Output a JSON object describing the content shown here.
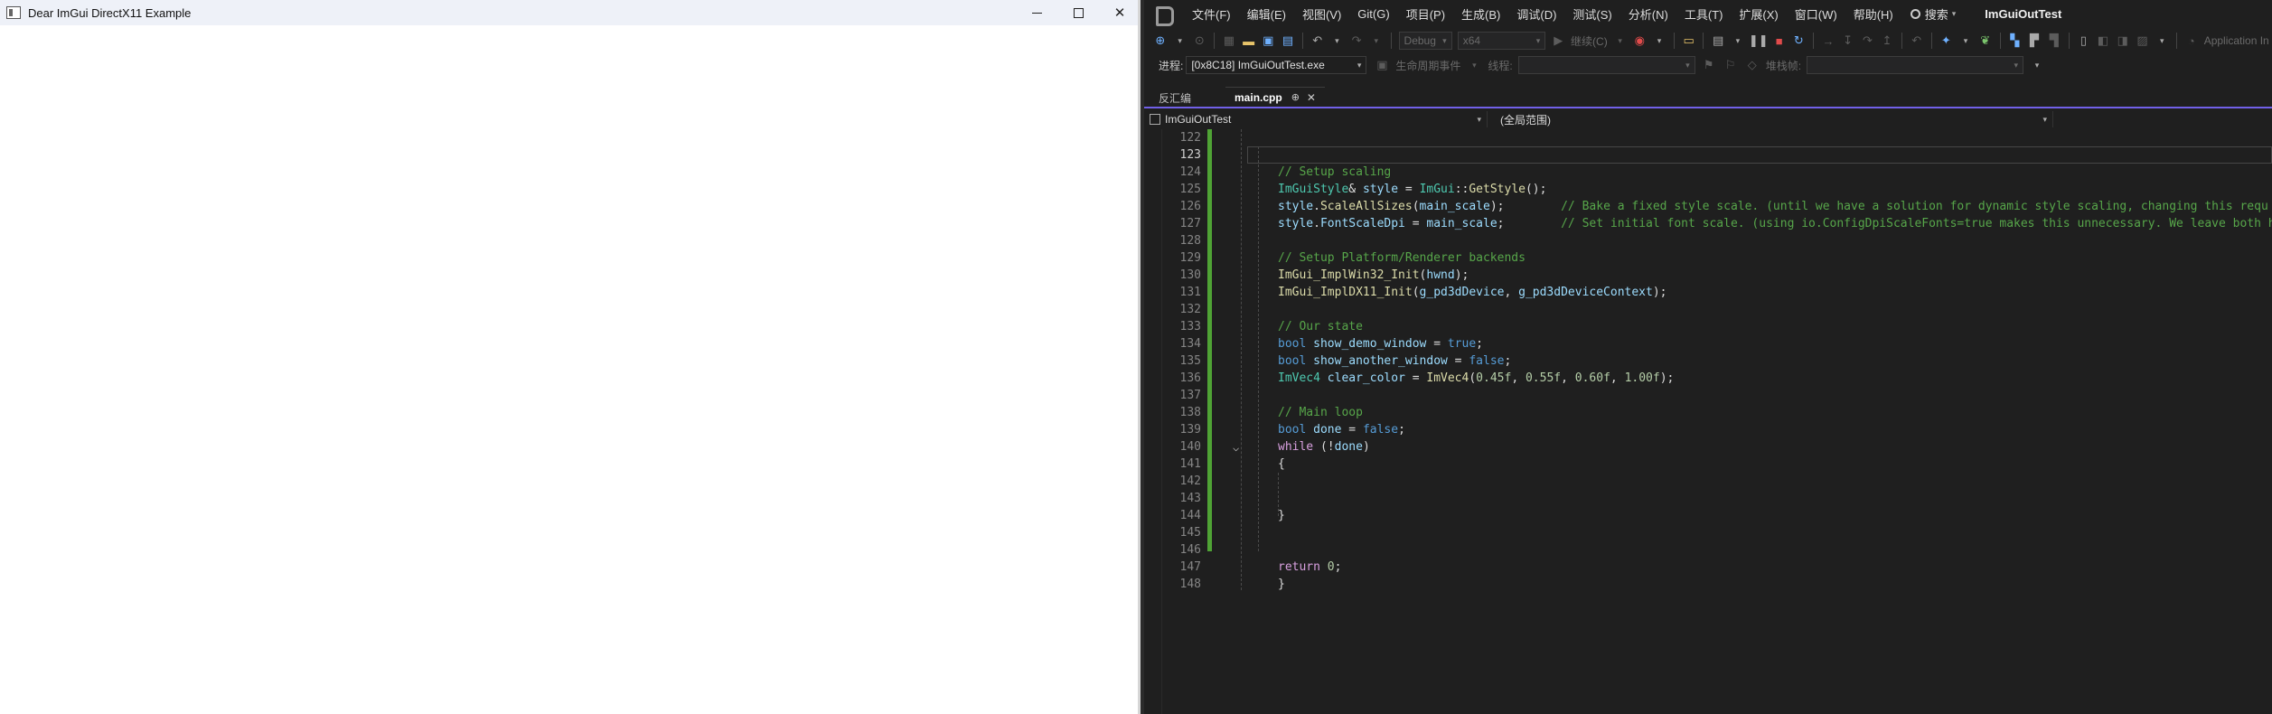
{
  "imgui_window": {
    "title": "Dear ImGui DirectX11 Example",
    "controls": {
      "minimize": "—",
      "maximize": "☐",
      "close": "✕"
    }
  },
  "vs": {
    "menu": [
      "文件(F)",
      "编辑(E)",
      "视图(V)",
      "Git(G)",
      "项目(P)",
      "生成(B)",
      "调试(D)",
      "测试(S)",
      "分析(N)",
      "工具(T)",
      "扩展(X)",
      "窗口(W)",
      "帮助(H)"
    ],
    "search_label": "搜索",
    "solution_name": "ImGuiOutTest",
    "toolbar": {
      "config": "Debug",
      "platform": "x64",
      "continue_label": "继续(C)",
      "app_insights": "Application In"
    },
    "toolbar2": {
      "process_label": "进程:",
      "process_value": "[0x8C18] ImGuiOutTest.exe",
      "lifecycle_label": "生命周期事件",
      "thread_label": "线程:",
      "stack_label": "堆栈帧:"
    },
    "tabs": [
      {
        "label": "反汇编",
        "active": false
      },
      {
        "label": "main.cpp",
        "active": true,
        "pin": "⊕",
        "close": "✕"
      }
    ],
    "nav": {
      "project": "ImGuiOutTest",
      "scope": "(全局范围)"
    },
    "editor": {
      "current_line": 123,
      "lines": [
        {
          "n": 122,
          "tokens": []
        },
        {
          "n": 123,
          "tokens": []
        },
        {
          "n": 124,
          "tokens": [
            [
              "c-cm",
              "// Setup scaling"
            ]
          ]
        },
        {
          "n": 125,
          "tokens": [
            [
              "c-ty",
              "ImGuiStyle"
            ],
            [
              "c-op",
              "& "
            ],
            [
              "c-var",
              "style"
            ],
            [
              "c-op",
              " = "
            ],
            [
              "c-ty",
              "ImGui"
            ],
            [
              "c-op",
              "::"
            ],
            [
              "c-fn",
              "GetStyle"
            ],
            [
              "c-op",
              "();"
            ]
          ]
        },
        {
          "n": 126,
          "tokens": [
            [
              "c-var",
              "style"
            ],
            [
              "c-op",
              "."
            ],
            [
              "c-fn",
              "ScaleAllSizes"
            ],
            [
              "c-op",
              "("
            ],
            [
              "c-var",
              "main_scale"
            ],
            [
              "c-op",
              ");        "
            ],
            [
              "c-cm",
              "// Bake a fixed style scale. (until we have a solution for dynamic style scaling, changing this requ"
            ]
          ]
        },
        {
          "n": 127,
          "tokens": [
            [
              "c-var",
              "style"
            ],
            [
              "c-op",
              "."
            ],
            [
              "c-var",
              "FontScaleDpi"
            ],
            [
              "c-op",
              " = "
            ],
            [
              "c-var",
              "main_scale"
            ],
            [
              "c-op",
              ";        "
            ],
            [
              "c-cm",
              "// Set initial font scale. (using io.ConfigDpiScaleFonts=true makes this unnecessary. We leave both h"
            ]
          ]
        },
        {
          "n": 128,
          "tokens": []
        },
        {
          "n": 129,
          "tokens": [
            [
              "c-cm",
              "// Setup Platform/Renderer backends"
            ]
          ]
        },
        {
          "n": 130,
          "tokens": [
            [
              "c-fn",
              "ImGui_ImplWin32_Init"
            ],
            [
              "c-op",
              "("
            ],
            [
              "c-var",
              "hwnd"
            ],
            [
              "c-op",
              ");"
            ]
          ]
        },
        {
          "n": 131,
          "tokens": [
            [
              "c-fn",
              "ImGui_ImplDX11_Init"
            ],
            [
              "c-op",
              "("
            ],
            [
              "c-var",
              "g_pd3dDevice"
            ],
            [
              "c-op",
              ", "
            ],
            [
              "c-var",
              "g_pd3dDeviceContext"
            ],
            [
              "c-op",
              ");"
            ]
          ]
        },
        {
          "n": 132,
          "tokens": []
        },
        {
          "n": 133,
          "tokens": [
            [
              "c-cm",
              "// Our state"
            ]
          ]
        },
        {
          "n": 134,
          "tokens": [
            [
              "c-kw",
              "bool"
            ],
            [
              "c-op",
              " "
            ],
            [
              "c-var",
              "show_demo_window"
            ],
            [
              "c-op",
              " = "
            ],
            [
              "c-kw",
              "true"
            ],
            [
              "c-op",
              ";"
            ]
          ]
        },
        {
          "n": 135,
          "tokens": [
            [
              "c-kw",
              "bool"
            ],
            [
              "c-op",
              " "
            ],
            [
              "c-var",
              "show_another_window"
            ],
            [
              "c-op",
              " = "
            ],
            [
              "c-kw",
              "false"
            ],
            [
              "c-op",
              ";"
            ]
          ]
        },
        {
          "n": 136,
          "tokens": [
            [
              "c-ty",
              "ImVec4"
            ],
            [
              "c-op",
              " "
            ],
            [
              "c-var",
              "clear_color"
            ],
            [
              "c-op",
              " = "
            ],
            [
              "c-fn",
              "ImVec4"
            ],
            [
              "c-op",
              "("
            ],
            [
              "c-num",
              "0.45f"
            ],
            [
              "c-op",
              ", "
            ],
            [
              "c-num",
              "0.55f"
            ],
            [
              "c-op",
              ", "
            ],
            [
              "c-num",
              "0.60f"
            ],
            [
              "c-op",
              ", "
            ],
            [
              "c-num",
              "1.00f"
            ],
            [
              "c-op",
              ");"
            ]
          ]
        },
        {
          "n": 137,
          "tokens": []
        },
        {
          "n": 138,
          "tokens": [
            [
              "c-cm",
              "// Main loop"
            ]
          ]
        },
        {
          "n": 139,
          "tokens": [
            [
              "c-kw",
              "bool"
            ],
            [
              "c-op",
              " "
            ],
            [
              "c-var",
              "done"
            ],
            [
              "c-op",
              " = "
            ],
            [
              "c-kw",
              "false"
            ],
            [
              "c-op",
              ";"
            ]
          ]
        },
        {
          "n": 140,
          "tokens": [
            [
              "c-ctl",
              "while"
            ],
            [
              "c-op",
              " (!"
            ],
            [
              "c-var",
              "done"
            ],
            [
              "c-op",
              ")"
            ]
          ],
          "fold": "⌵"
        },
        {
          "n": 141,
          "tokens": [
            [
              "c-op",
              "{"
            ]
          ]
        },
        {
          "n": 142,
          "tokens": []
        },
        {
          "n": 143,
          "tokens": []
        },
        {
          "n": 144,
          "tokens": [
            [
              "c-op",
              "}"
            ]
          ]
        },
        {
          "n": 145,
          "tokens": []
        },
        {
          "n": 146,
          "tokens": []
        },
        {
          "n": 147,
          "tokens": [
            [
              "c-ctl",
              "return"
            ],
            [
              "c-op",
              " "
            ],
            [
              "c-num",
              "0"
            ],
            [
              "c-op",
              ";"
            ]
          ]
        },
        {
          "n": 148,
          "tokens": [
            [
              "c-op",
              "}"
            ]
          ]
        }
      ]
    }
  }
}
